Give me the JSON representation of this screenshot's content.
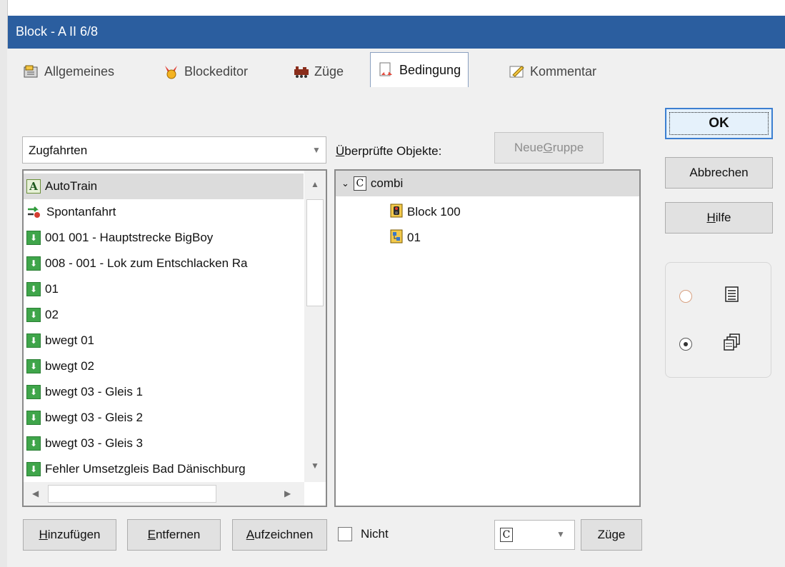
{
  "window": {
    "title": "Block - A II 6/8"
  },
  "tabs": [
    {
      "label": "Allgemeines",
      "icon": "properties-icon"
    },
    {
      "label": "Blockeditor",
      "icon": "block-editor-icon"
    },
    {
      "label": "Züge",
      "icon": "trains-icon"
    },
    {
      "label": "Bedingung",
      "icon": "condition-icon",
      "active": true
    },
    {
      "label": "Kommentar",
      "icon": "comment-icon"
    }
  ],
  "filter_combo": {
    "value": "Zugfahrten"
  },
  "objects_label": {
    "first": "Ü",
    "rest": "berprüfte Objekte:"
  },
  "new_group_button": {
    "label_pre": "Neue ",
    "label_u": "G",
    "label_post": "ruppe"
  },
  "train_list": [
    {
      "label": "AutoTrain",
      "icon": "autotrain-icon"
    },
    {
      "label": "Spontanfahrt",
      "icon": "spontaneous-icon"
    },
    {
      "label": "001 001 - Hauptstrecke BigBoy",
      "icon": "route-icon"
    },
    {
      "label": "008 - 001 - Lok zum Entschlacken Ra",
      "icon": "route-icon"
    },
    {
      "label": "01",
      "icon": "route-icon"
    },
    {
      "label": "02",
      "icon": "route-icon"
    },
    {
      "label": "bwegt 01",
      "icon": "route-icon"
    },
    {
      "label": "bwegt 02",
      "icon": "route-icon"
    },
    {
      "label": "bwegt 03 - Gleis 1",
      "icon": "route-icon"
    },
    {
      "label": "bwegt 03 - Gleis 2",
      "icon": "route-icon"
    },
    {
      "label": "bwegt 03 - Gleis 3",
      "icon": "route-icon"
    },
    {
      "label": "Fehler Umsetzgleis Bad Dänischburg",
      "icon": "route-icon"
    }
  ],
  "tree": {
    "root": {
      "label": "combi",
      "badge": "C"
    },
    "children": [
      {
        "label": "Block 100",
        "icon": "block-icon"
      },
      {
        "label": "01",
        "icon": "group-icon"
      }
    ]
  },
  "buttons": {
    "ok": "OK",
    "cancel": "Abbrechen",
    "help": {
      "u": "H",
      "rest": "ilfe"
    },
    "add": {
      "u": "H",
      "rest": "inzufügen"
    },
    "remove": {
      "u": "E",
      "rest": "ntfernen"
    },
    "record": {
      "u": "A",
      "rest": "ufzeichnen"
    },
    "trains": "Züge"
  },
  "not_checkbox": {
    "label": "Nicht",
    "checked": false
  },
  "combo_small": {
    "value": "C"
  },
  "view_options": {
    "selected": "cascade"
  }
}
